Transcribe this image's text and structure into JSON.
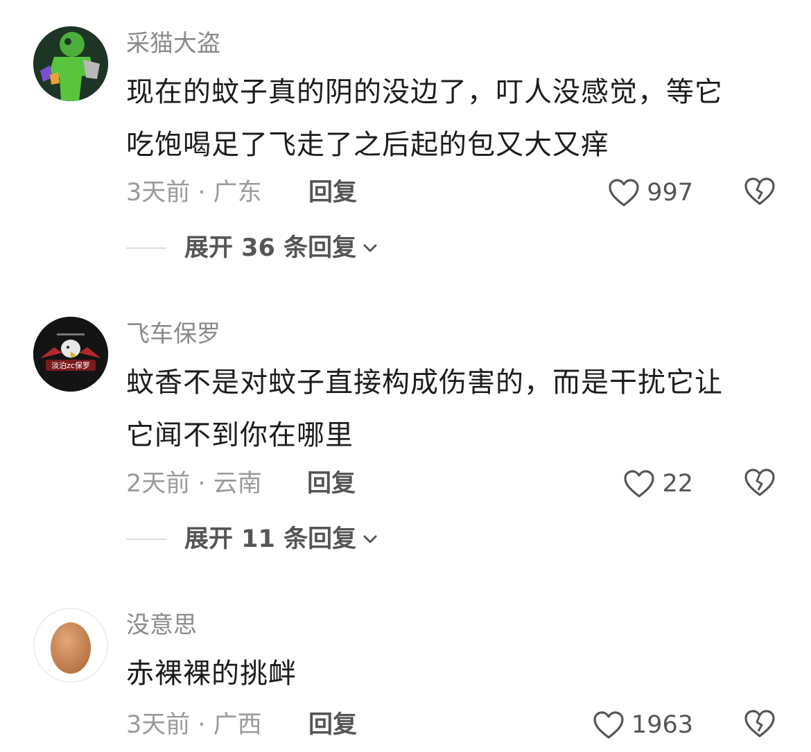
{
  "comments": [
    {
      "username": "采猫大盗",
      "text_line1": "现在的蚊子真的阴的没边了，叮人没感觉，等它",
      "text_line2": "吃饱喝足了飞走了之后起的包又大又痒",
      "meta": "3天前 · 广东",
      "reply_label": "回复",
      "likes": "997",
      "expand_label": "展开 36 条回复",
      "avatar_icon": "green-figure-avatar"
    },
    {
      "username": "飞车保罗",
      "text_line1": "蚊香不是对蚊子直接构成伤害的，而是干扰它让",
      "text_line2": "它闻不到你在哪里",
      "meta": "2天前 · 云南",
      "reply_label": "回复",
      "likes": "22",
      "expand_label": "展开 11 条回复",
      "avatar_icon": "eagle-esports-avatar",
      "avatar_text": "淡泊zc保罗"
    },
    {
      "username": "没意思",
      "text_line1": "赤裸裸的挑衅",
      "meta": "3天前 · 广西",
      "reply_label": "回复",
      "likes": "1963",
      "avatar_icon": "egg-avatar"
    }
  ],
  "colors": {
    "username": "#8a8a8a",
    "text": "#1c1c1c",
    "meta": "#9a9a9a",
    "action": "#555555"
  },
  "icons": {
    "like": "heart-outline-icon",
    "dislike": "broken-heart-icon",
    "expand": "chevron-down-icon"
  }
}
